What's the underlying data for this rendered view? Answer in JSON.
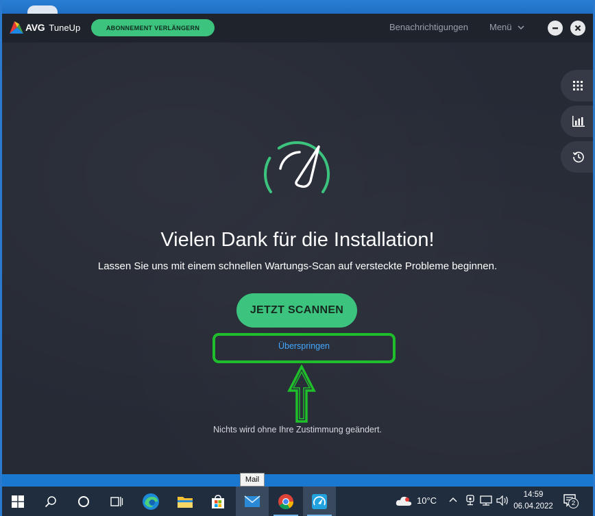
{
  "app": {
    "name": "TuneUp",
    "brand": "AVG",
    "renew_label": "ABONNEMENT VERLÄNGERN",
    "notifications_label": "Benachrichtigungen",
    "menu_label": "Menü",
    "accent_color": "#3cc47f"
  },
  "side_panel": {
    "items": [
      {
        "icon": "apps-grid-icon"
      },
      {
        "icon": "bar-chart-icon"
      },
      {
        "icon": "history-icon"
      }
    ]
  },
  "main": {
    "icon": "speedometer-icon",
    "headline": "Vielen Dank für die Installation!",
    "subline": "Lassen Sie uns mit einem schnellen Wartungs-Scan auf versteckte Probleme beginnen.",
    "scan_button": "JETZT SCANNEN",
    "skip_link": "Überspringen",
    "consent_note": "Nichts wird ohne Ihre Zustimmung geändert.",
    "highlight_color": "#1fbf2b"
  },
  "taskbar": {
    "tooltip": "Mail",
    "icons": [
      "windows-start-icon",
      "search-icon",
      "cortana-icon",
      "task-view-icon",
      "edge-icon",
      "file-explorer-icon",
      "store-icon",
      "mail-icon",
      "chrome-icon",
      "avg-tuneup-icon"
    ],
    "weather": "10°C",
    "time": "14:59",
    "date": "06.04.2022",
    "notification_count": "2"
  }
}
